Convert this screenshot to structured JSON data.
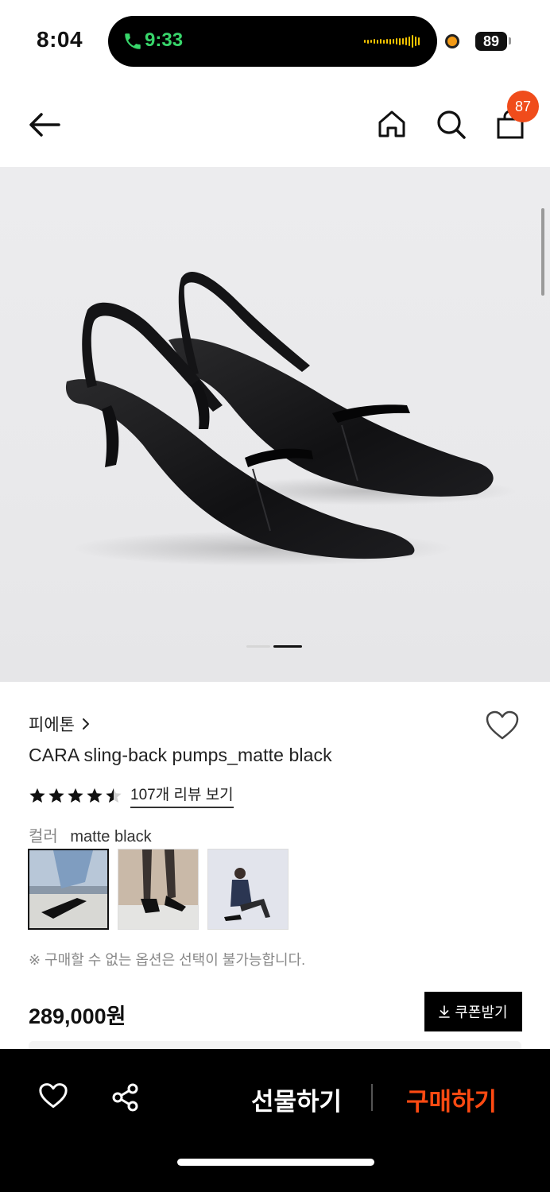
{
  "status_bar": {
    "time": "8:04",
    "call_time": "9:33",
    "battery": "89"
  },
  "nav": {
    "back_icon": "arrow-left-icon",
    "home_icon": "home-icon",
    "search_icon": "search-icon",
    "cart_icon": "shopping-bag-icon",
    "cart_count": "87"
  },
  "gallery": {
    "current_page": 2,
    "page_count": 2
  },
  "product": {
    "brand": "피에톤",
    "name": "CARA sling-back pumps_matte black",
    "rating": 4.5,
    "review_link": "107개 리뷰 보기",
    "color_label": "컬러",
    "color_value": "matte black",
    "notice": "※ 구매할 수 없는 옵션은 선택이 불가능합니다.",
    "price": "289,000원",
    "coupon_label": "쿠폰받기"
  },
  "bottom_bar": {
    "gift_label": "선물하기",
    "buy_label": "구매하기"
  },
  "colors": {
    "accent": "#ff4a12",
    "badge": "#f04c1b",
    "call_green": "#38d66b"
  }
}
